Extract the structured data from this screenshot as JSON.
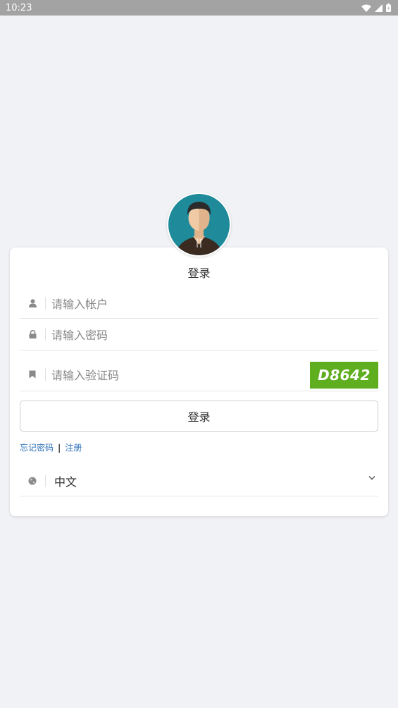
{
  "status_bar": {
    "time": "10:23"
  },
  "form": {
    "title": "登录",
    "account_placeholder": "请输入帐户",
    "password_placeholder": "请输入密码",
    "captcha_placeholder": "请输入验证码",
    "captcha_code": "D8642",
    "login_label": "登录"
  },
  "links": {
    "forgot_password": "忘记密码",
    "separator": "|",
    "register": "注册"
  },
  "language": {
    "selected": "中文"
  },
  "colors": {
    "background": "#f1f2f5",
    "captcha_bg": "#5fae1f",
    "link": "#2a6fb8",
    "avatar_bg": "#1e8a9a"
  },
  "icons": {
    "account": "user-icon",
    "password": "lock-icon",
    "captcha": "bookmark-icon",
    "language": "globe-icon",
    "dropdown": "chevron-down-icon"
  }
}
